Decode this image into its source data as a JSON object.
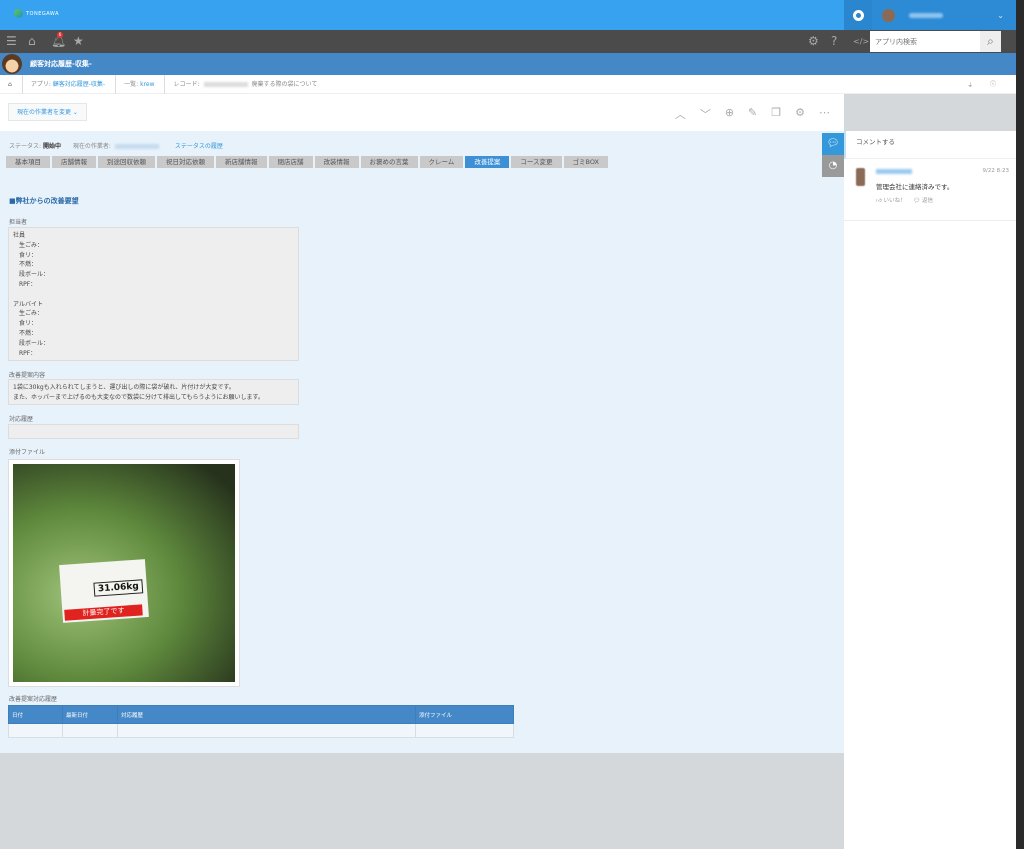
{
  "header": {
    "logo_text": "TONEGAWA",
    "notification_count": "6",
    "search_placeholder": "アプリ内検索"
  },
  "app": {
    "title": "顧客対応履歴-収集-"
  },
  "breadcrumb": {
    "app_prefix": "アプリ:",
    "app_name": "顧客対応履歴-収集-",
    "list_prefix": "一覧:",
    "list_name": "krew",
    "record_prefix": "レコード:",
    "record_title": "廃棄する際の袋について"
  },
  "toolbar": {
    "change_assignee": "現在の作業者を変更"
  },
  "status": {
    "label": "ステータス:",
    "value": "開始中",
    "assignee_label": "現在の作業者:",
    "history_link": "ステータスの履歴"
  },
  "tabs": [
    "基本項目",
    "店舗情報",
    "別途回収依頼",
    "祝日対応依頼",
    "新店舗情報",
    "閉店店舗",
    "改装情報",
    "お褒めの言葉",
    "クレーム",
    "改善提案",
    "コース変更",
    "ゴミBOX"
  ],
  "active_tab": "改善提案",
  "section_title": "■弊社からの改善要望",
  "fields": {
    "staff_label": "担当者",
    "staff_value": "社員\n　生ごみ：\n　食リ：\n　不燃：\n　段ボール：\n　RPF：\n\nアルバイト\n　生ごみ：\n　食リ：\n　不燃：\n　段ボール：\n　RPF：",
    "proposal_label": "改善提案内容",
    "proposal_value": "1袋に30kgも入れられてしまうと、運び出しの際に袋が破れ、片付けが大変です。\nまた、ホッパーまで上げるのも大変なので数袋に分けて排出してもらうようにお願いします。",
    "history_label": "対応履歴",
    "history_value": "",
    "attachment_label": "添付ファイル",
    "photo_weight": "31.06kg",
    "photo_stamp": "計量完了です"
  },
  "table": {
    "label": "改善提案対応履歴",
    "headers": [
      "日付",
      "最新日付",
      "対応履歴",
      "添付ファイル"
    ]
  },
  "sidebar": {
    "comment_prompt": "コメントする",
    "comments": [
      {
        "time": "9/22 8:23",
        "text": "管理会社に連絡済みです。",
        "like": "いいね！",
        "reply": "返信"
      }
    ]
  }
}
